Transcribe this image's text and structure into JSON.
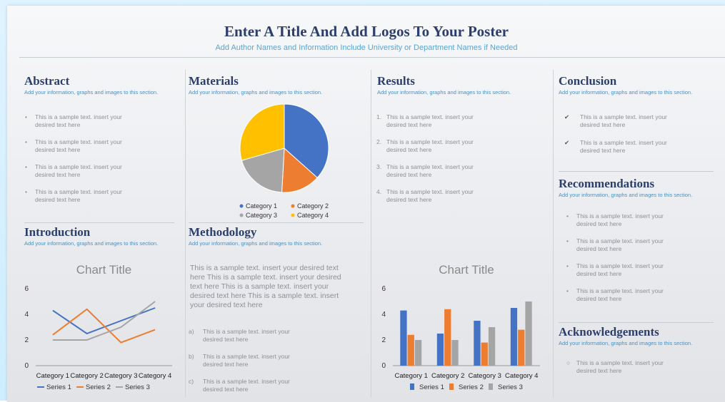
{
  "header": {
    "title": "Enter A Title And Add Logos To Your Poster",
    "subtitle": "Add Author Names and Information Include University or Department Names if Needed"
  },
  "sample_text": "This is a sample text. insert your desired text here",
  "abstract": {
    "title": "Abstract",
    "sub": "Add your information, graphs and images to this section.",
    "items": [
      {
        "marker": "•",
        "text": "This is a sample text. insert your desired text here"
      },
      {
        "marker": "•",
        "text": "This is a sample text. insert your desired text here"
      },
      {
        "marker": "•",
        "text": "This is a sample text. insert your desired text here"
      },
      {
        "marker": "•",
        "text": "This is a sample text. insert your desired text here"
      }
    ]
  },
  "introduction": {
    "title": "Introduction",
    "sub": "Add your information, graphs and images to this section."
  },
  "materials": {
    "title": "Materials",
    "sub": "Add your information, graphs and images to this section."
  },
  "methodology": {
    "title": "Methodology",
    "sub": "Add your information, graphs and images to this section.",
    "paragraph": "This is a sample text. insert your desired text here This is a sample text. insert your desired text here This is a sample text. insert your desired text here This is a sample text. insert your desired text here",
    "items": [
      {
        "marker": "a)",
        "text": "This is a sample text. insert your desired text here"
      },
      {
        "marker": "b)",
        "text": "This is a sample text. insert your desired text here"
      },
      {
        "marker": "c)",
        "text": "This is a sample text. insert your desired text here"
      }
    ]
  },
  "results": {
    "title": "Results",
    "sub": "Add your information, graphs and images to this section.",
    "items": [
      {
        "marker": "1.",
        "text": "This is a sample text. insert your desired text here"
      },
      {
        "marker": "2.",
        "text": "This is a sample text. insert your desired text here"
      },
      {
        "marker": "3.",
        "text": "This is a sample text. insert your desired text here"
      },
      {
        "marker": "4.",
        "text": "This is a sample text. insert your desired text here"
      }
    ]
  },
  "conclusion": {
    "title": "Conclusion",
    "sub": "Add your information, graphs and images to this section.",
    "items": [
      {
        "marker": "✔",
        "text": "This is a sample text. insert your desired text here"
      },
      {
        "marker": "✔",
        "text": "This is a sample text. insert your desired text here"
      }
    ]
  },
  "recommendations": {
    "title": "Recommendations",
    "sub": "Add your information, graphs and images to this section.",
    "items": [
      {
        "marker": "•",
        "text": "This is a sample text. insert your desired text here"
      },
      {
        "marker": "•",
        "text": "This is a sample text. insert your desired text here"
      },
      {
        "marker": "•",
        "text": "This is a sample text. insert your desired text here"
      },
      {
        "marker": "•",
        "text": "This is a sample text. insert your desired text here"
      }
    ]
  },
  "acknowledgements": {
    "title": "Acknowledgements",
    "sub": "Add your information, graphs and images to this section.",
    "items": [
      {
        "marker": "○",
        "text": "This is a sample text. insert your desired text here"
      }
    ]
  },
  "colors": {
    "series1": "#4472c4",
    "series2": "#ed7d31",
    "series3": "#a5a5a5",
    "series4": "#ffc000",
    "title": "#2c3e6b",
    "accent": "#4a90c2"
  },
  "chart_data": [
    {
      "type": "pie",
      "categories": [
        "Category 1",
        "Category 2",
        "Category 3",
        "Category 4"
      ],
      "values": [
        8.2,
        3.2,
        4.4,
        6.6
      ],
      "legend": "bottom"
    },
    {
      "type": "line",
      "title": "Chart Title",
      "categories": [
        "Category 1",
        "Category 2",
        "Category 3",
        "Category 4"
      ],
      "series": [
        {
          "name": "Series 1",
          "values": [
            4.3,
            2.5,
            3.5,
            4.5
          ]
        },
        {
          "name": "Series 2",
          "values": [
            2.4,
            4.4,
            1.8,
            2.8
          ]
        },
        {
          "name": "Series 3",
          "values": [
            2,
            2,
            3,
            5
          ]
        }
      ],
      "ylim": [
        0,
        6
      ],
      "yticks": [
        0,
        2,
        4,
        6
      ],
      "grid": false,
      "legend": "bottom"
    },
    {
      "type": "bar",
      "title": "Chart Title",
      "categories": [
        "Category 1",
        "Category 2",
        "Category 3",
        "Category 4"
      ],
      "series": [
        {
          "name": "Series 1",
          "values": [
            4.3,
            2.5,
            3.5,
            4.5
          ]
        },
        {
          "name": "Series 2",
          "values": [
            2.4,
            4.4,
            1.8,
            2.8
          ]
        },
        {
          "name": "Series 3",
          "values": [
            2,
            2,
            3,
            5
          ]
        }
      ],
      "ylim": [
        0,
        6
      ],
      "yticks": [
        0,
        2,
        4,
        6
      ],
      "grid": false,
      "legend": "bottom"
    }
  ]
}
